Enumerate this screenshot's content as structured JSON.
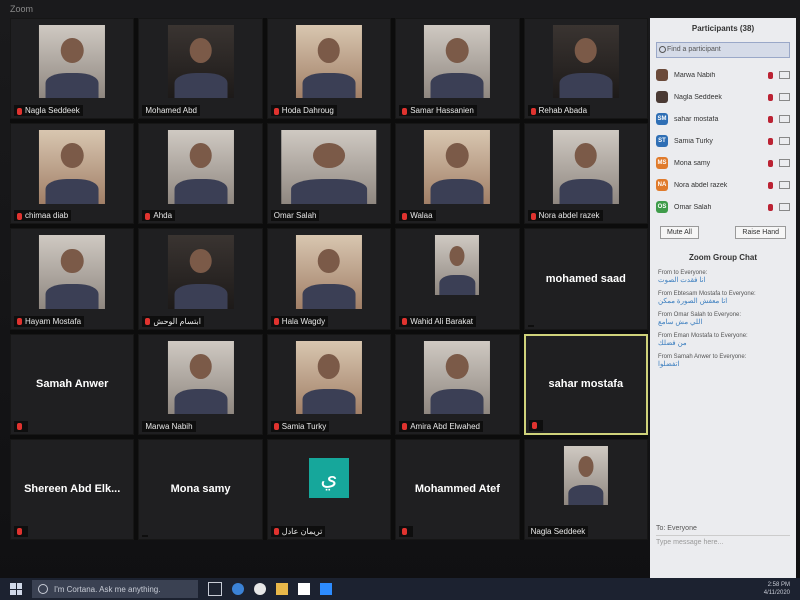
{
  "window": {
    "title": "Zoom"
  },
  "tiles": [
    {
      "name": "Nagla Seddeek",
      "muted": true,
      "type": "video"
    },
    {
      "name": "Mohamed Abd",
      "muted": false,
      "type": "video"
    },
    {
      "name": "Hoda Dahroug",
      "muted": true,
      "type": "video"
    },
    {
      "name": "Samar Hassanien",
      "muted": true,
      "type": "video"
    },
    {
      "name": "Rehab Abada",
      "muted": true,
      "type": "video"
    },
    {
      "name": "chimaa diab",
      "muted": true,
      "type": "video"
    },
    {
      "name": "Ahda",
      "muted": true,
      "type": "video"
    },
    {
      "name": "Omar Salah",
      "muted": false,
      "type": "video"
    },
    {
      "name": "Walaa",
      "muted": true,
      "type": "video"
    },
    {
      "name": "Nora abdel razek",
      "muted": true,
      "type": "video"
    },
    {
      "name": "Hayam Mostafa",
      "muted": true,
      "type": "video"
    },
    {
      "name": "ابتسام الوحش",
      "muted": true,
      "type": "video"
    },
    {
      "name": "Hala Wagdy",
      "muted": true,
      "type": "video"
    },
    {
      "name": "Wahid Ali Barakat",
      "muted": true,
      "type": "video"
    },
    {
      "name": "mohamed saad",
      "muted": false,
      "type": "name"
    },
    {
      "name": "Samah Anwer",
      "muted": true,
      "type": "name"
    },
    {
      "name": "Marwa Nabih",
      "muted": false,
      "type": "video"
    },
    {
      "name": "Samia Turky",
      "muted": true,
      "type": "video"
    },
    {
      "name": "Amira Abd Elwahed",
      "muted": true,
      "type": "video"
    },
    {
      "name": "sahar mostafa",
      "muted": true,
      "type": "name",
      "active": true
    },
    {
      "name": "Shereen Abd Elk...",
      "muted": true,
      "type": "name"
    },
    {
      "name": "Mona samy",
      "muted": false,
      "type": "name"
    },
    {
      "name": "تريمان عادل",
      "muted": true,
      "type": "logo",
      "logo_char": "ي"
    },
    {
      "name": "Mohammed Atef",
      "muted": true,
      "type": "name"
    },
    {
      "name": "Nagla Seddeek",
      "muted": false,
      "type": "video"
    }
  ],
  "participants_panel": {
    "title": "Participants (38)",
    "search_placeholder": "Find a participant",
    "items": [
      {
        "initials": "",
        "name": "Marwa Nabih",
        "color": "#6b4a3a"
      },
      {
        "initials": "",
        "name": "Nagla Seddeek",
        "color": "#4a3a34"
      },
      {
        "initials": "SM",
        "name": "sahar mostafa",
        "color": "#2f6fb5"
      },
      {
        "initials": "ST",
        "name": "Samia Turky",
        "color": "#2f6fb5"
      },
      {
        "initials": "MS",
        "name": "Mona samy",
        "color": "#e07b2c"
      },
      {
        "initials": "NA",
        "name": "Nora abdel razek",
        "color": "#e07b2c"
      },
      {
        "initials": "OS",
        "name": "Omar Salah",
        "color": "#3f9c4a"
      }
    ],
    "mute_all": "Mute All",
    "raise_hand": "Raise Hand"
  },
  "chat": {
    "title": "Zoom Group Chat",
    "messages": [
      {
        "from": "From to Everyone:",
        "text": "انا فقدت الصوت"
      },
      {
        "from": "From Ebtesam Mostafa to Everyone:",
        "text": "اتا معفش الصورة ممكن"
      },
      {
        "from": "From Omar Salah to Everyone:",
        "text": "اللي مش سامع"
      },
      {
        "from": "From Eman Mostafa to Everyone:",
        "text": "من فضلك"
      },
      {
        "from": "From Samah Anwer to Everyone:",
        "text": "اتفضلوا"
      }
    ],
    "to_label": "To: Everyone",
    "input_placeholder": "Type message here..."
  },
  "taskbar": {
    "search_placeholder": "I'm Cortana. Ask me anything.",
    "time": "2:58 PM",
    "date": "4/11/2020"
  }
}
